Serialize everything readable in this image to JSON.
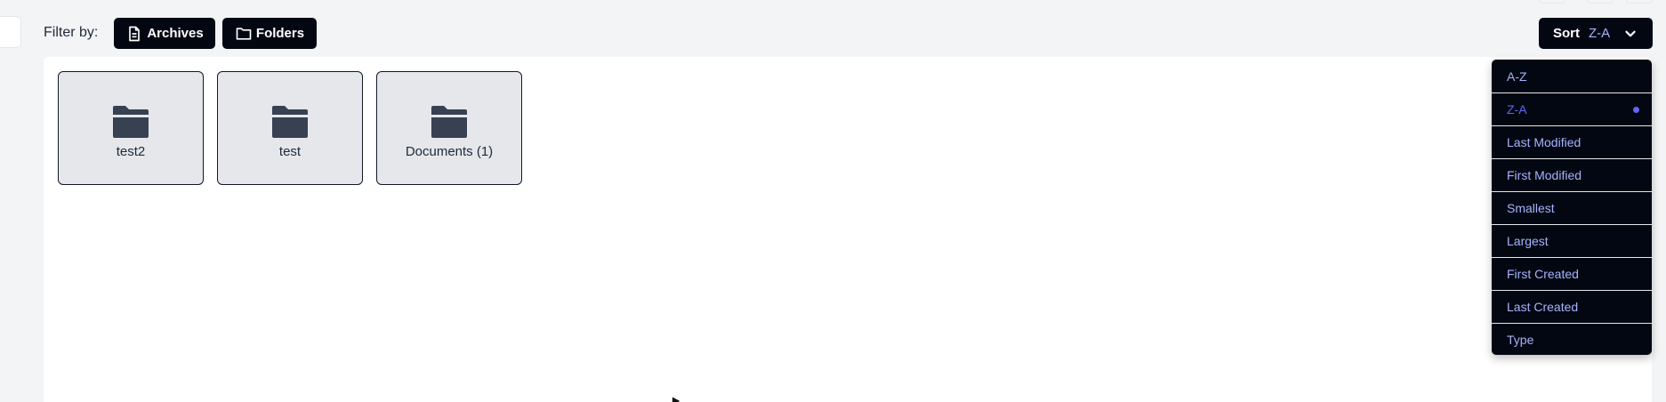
{
  "filter": {
    "label": "Filter by:",
    "archives_label": "Archives",
    "folders_label": "Folders"
  },
  "sort": {
    "label": "Sort",
    "value": "Z-A"
  },
  "folders": [
    {
      "name": "test2"
    },
    {
      "name": "test"
    },
    {
      "name": "Documents (1)"
    }
  ],
  "sort_options": [
    {
      "label": "A-Z",
      "selected": false
    },
    {
      "label": "Z-A",
      "selected": true
    },
    {
      "label": "Last Modified",
      "selected": false
    },
    {
      "label": "First Modified",
      "selected": false
    },
    {
      "label": "Smallest",
      "selected": false
    },
    {
      "label": "Largest",
      "selected": false
    },
    {
      "label": "First Created",
      "selected": false
    },
    {
      "label": "Last Created",
      "selected": false
    },
    {
      "label": "Type",
      "selected": false
    }
  ],
  "icons": {
    "archives": "document-icon",
    "folders": "folder-outline-icon",
    "folder_card": "folder-icon",
    "sort_toggle": "chevron-down-icon"
  },
  "colors": {
    "button_bg": "#030712",
    "accent": "#6366f1",
    "option_text": "#a5b4fc",
    "card_bg": "#e5e7eb"
  }
}
